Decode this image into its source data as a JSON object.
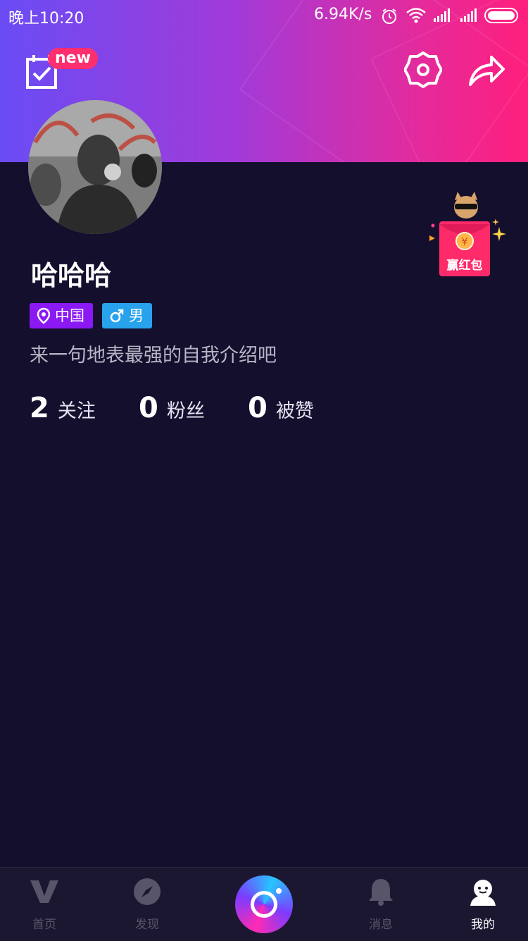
{
  "status_bar": {
    "time": "晚上10:20",
    "network_speed": "6.94K/s",
    "icons": [
      "alarm-icon",
      "wifi-icon",
      "signal-icon",
      "signal-icon",
      "battery-icon"
    ]
  },
  "header": {
    "checkin_badge": "new",
    "right_icons": [
      "settings-icon",
      "share-icon"
    ],
    "gradient_colors": [
      "#6a4cf5",
      "#ff1f7d"
    ]
  },
  "profile": {
    "name": "哈哈哈",
    "tags": {
      "location": "中国",
      "gender": "男"
    },
    "bio": "来一句地表最强的自我介绍吧",
    "stats": [
      {
        "value": "2",
        "label": "关注"
      },
      {
        "value": "0",
        "label": "粉丝"
      },
      {
        "value": "0",
        "label": "被赞"
      }
    ]
  },
  "promo": {
    "label": "赢红包",
    "coin_symbol": "¥"
  },
  "tabbar": {
    "items": [
      {
        "label": "首页",
        "icon": "home-v-icon",
        "active": false
      },
      {
        "label": "发现",
        "icon": "compass-icon",
        "active": false
      },
      {
        "label": "",
        "icon": "camera-icon",
        "active": false
      },
      {
        "label": "消息",
        "icon": "bell-icon",
        "active": false
      },
      {
        "label": "我的",
        "icon": "profile-icon",
        "active": true
      }
    ]
  },
  "colors": {
    "background": "#150f2e",
    "location_tag": "#8b19f4",
    "gender_tag": "#28a2ec",
    "badge": "#ff2e6e"
  }
}
